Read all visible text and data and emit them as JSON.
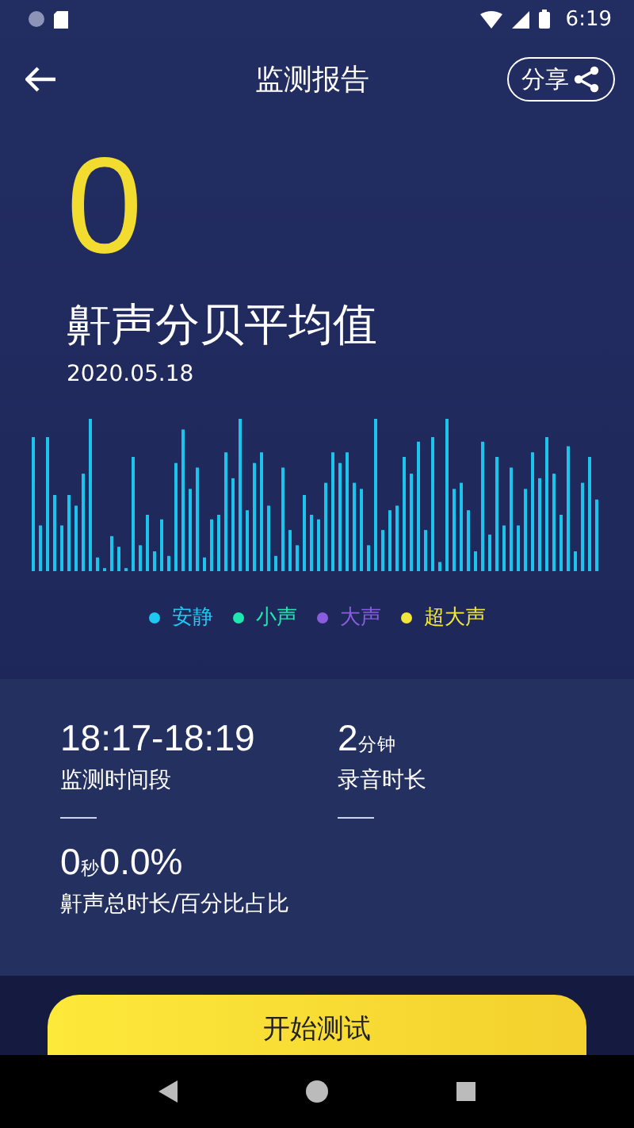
{
  "status_bar": {
    "time": "6:19"
  },
  "header": {
    "title": "监测报告",
    "share": "分享"
  },
  "score": "0",
  "title": "鼾声分贝平均值",
  "date": "2020.05.18",
  "legend": [
    {
      "label": "安静",
      "color": "#1ec8f0"
    },
    {
      "label": "小声",
      "color": "#1ee8b0"
    },
    {
      "label": "大声",
      "color": "#8a5ce0"
    },
    {
      "label": "超大声",
      "color": "#f2e63a"
    }
  ],
  "stats": [
    {
      "value": "18:17-18:19",
      "label": "监测时间段",
      "dash": true
    },
    {
      "value": "2$_{分钟}$",
      "label": "录音时长",
      "dash": true
    },
    {
      "value": "0$_{秒}$0.0%",
      "label": "鼾声总时长/百分比占比",
      "dash": false
    }
  ],
  "button": "开始测试"
}
